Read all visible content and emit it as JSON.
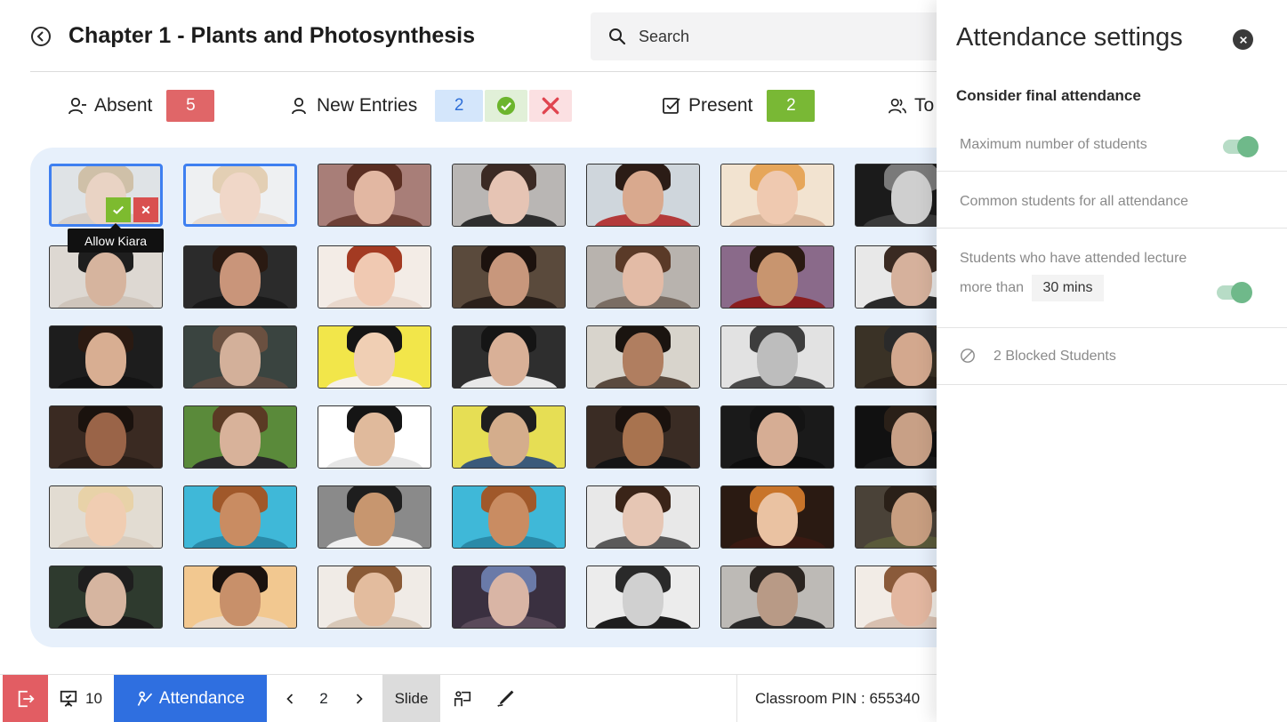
{
  "header": {
    "title": "Chapter 1 - Plants and Photosynthesis",
    "search_placeholder": "Search"
  },
  "stats": {
    "absent_label": "Absent",
    "absent_count": "5",
    "new_entries_label": "New Entries",
    "new_entries_count": "2",
    "present_label": "Present",
    "present_count": "2",
    "total_label": "To"
  },
  "tooltip": "Allow Kiara",
  "colors": {
    "primary": "#2f6fe0",
    "absent": "#e06668",
    "present": "#79b835",
    "panel_toggle": "#6fb98a"
  },
  "students": [
    {
      "name": "Kiara",
      "skin": "#e9d3c4",
      "hair": "#cfc0a8",
      "bg": "#dfe3e6",
      "body": "#d7cfc8"
    },
    {
      "name": "",
      "skin": "#f0d7c8",
      "hair": "#e3cfb4",
      "bg": "#eef0f2",
      "body": "#e8dcd2"
    },
    {
      "name": "",
      "skin": "#e2b7a2",
      "hair": "#5a2e22",
      "bg": "#a87e78",
      "body": "#6d4036"
    },
    {
      "name": "",
      "skin": "#e6c4b4",
      "hair": "#3b2a24",
      "bg": "#b9b6b4",
      "body": "#2e2e2e"
    },
    {
      "name": "",
      "skin": "#d9a98e",
      "hair": "#2b1c16",
      "bg": "#cfd6dc",
      "body": "#b33a3a"
    },
    {
      "name": "",
      "skin": "#efc9b0",
      "hair": "#e6a65a",
      "bg": "#f2e3d0",
      "body": "#d8b59a"
    },
    {
      "name": "",
      "skin": "#cfcfcf",
      "hair": "#7a7a7a",
      "bg": "#1b1b1b",
      "body": "#3a3a3a"
    },
    {
      "name": "",
      "skin": "#d6b49e",
      "hair": "#1e1e1e",
      "bg": "#ddd8d2",
      "body": "#cfc5bb"
    },
    {
      "name": "",
      "skin": "#c9957a",
      "hair": "#2a1a12",
      "bg": "#2b2b2b",
      "body": "#1a1a1a"
    },
    {
      "name": "",
      "skin": "#f0c9b2",
      "hair": "#a33a22",
      "bg": "#f3ece6",
      "body": "#e9d8cc"
    },
    {
      "name": "",
      "skin": "#c8977c",
      "hair": "#1c120e",
      "bg": "#5a4a3c",
      "body": "#2a201a"
    },
    {
      "name": "",
      "skin": "#e3bba6",
      "hair": "#5a3a28",
      "bg": "#b8b3ae",
      "body": "#7a6d63"
    },
    {
      "name": "",
      "skin": "#c8956f",
      "hair": "#2a1a12",
      "bg": "#8a6a8a",
      "body": "#8a1e1e"
    },
    {
      "name": "",
      "skin": "#d6b19c",
      "hair": "#3a2a22",
      "bg": "#e8e8e8",
      "body": "#2a2a2a"
    },
    {
      "name": "",
      "skin": "#d8ae92",
      "hair": "#2a1a12",
      "bg": "#1d1d1d",
      "body": "#141414"
    },
    {
      "name": "",
      "skin": "#d3b09a",
      "hair": "#6a5040",
      "bg": "#3a4440",
      "body": "#5a4a40"
    },
    {
      "name": "",
      "skin": "#f0cfb4",
      "hair": "#151515",
      "bg": "#f2e64a",
      "body": "#f5f0ea"
    },
    {
      "name": "",
      "skin": "#d9b097",
      "hair": "#151515",
      "bg": "#2e2e2e",
      "body": "#e8e8e8"
    },
    {
      "name": "",
      "skin": "#b07e60",
      "hair": "#1a1410",
      "bg": "#d8d4cc",
      "body": "#5a4a3e"
    },
    {
      "name": "",
      "skin": "#bdbdbd",
      "hair": "#3d3d3d",
      "bg": "#e2e2e2",
      "body": "#4a4a4a"
    },
    {
      "name": "",
      "skin": "#d3a88e",
      "hair": "#2a2a2a",
      "bg": "#3a3226",
      "body": "#2a221a"
    },
    {
      "name": "",
      "skin": "#9a6448",
      "hair": "#1a120e",
      "bg": "#3a2a22",
      "body": "#2a1e18"
    },
    {
      "name": "",
      "skin": "#d8b29a",
      "hair": "#5a3a24",
      "bg": "#5a8a3a",
      "body": "#2a2a2a"
    },
    {
      "name": "",
      "skin": "#e0ba9c",
      "hair": "#151515",
      "bg": "#ffffff",
      "body": "#e6e6e6"
    },
    {
      "name": "",
      "skin": "#d4ad8c",
      "hair": "#1e1e1e",
      "bg": "#e6de54",
      "body": "#3a5a7a"
    },
    {
      "name": "",
      "skin": "#a8734f",
      "hair": "#1a120e",
      "bg": "#3a2c24",
      "body": "#151515"
    },
    {
      "name": "",
      "skin": "#d6ad94",
      "hair": "#141414",
      "bg": "#1a1a1a",
      "body": "#0e0e0e"
    },
    {
      "name": "",
      "skin": "#c8a086",
      "hair": "#2a2018",
      "bg": "#111111",
      "body": "#1a1a1a"
    },
    {
      "name": "",
      "skin": "#f0cdb2",
      "hair": "#e8d2a8",
      "bg": "#e2dcd2",
      "body": "#d8ccbe"
    },
    {
      "name": "",
      "skin": "#c98c62",
      "hair": "#a0582a",
      "bg": "#3fb8d8",
      "body": "#2a8aa8"
    },
    {
      "name": "",
      "skin": "#c7966f",
      "hair": "#1e1e1e",
      "bg": "#8a8a8a",
      "body": "#f0f0f0"
    },
    {
      "name": "",
      "skin": "#c98c62",
      "hair": "#a0582a",
      "bg": "#3fb8d8",
      "body": "#2a8aa8"
    },
    {
      "name": "",
      "skin": "#e6c6b4",
      "hair": "#3a2418",
      "bg": "#e8e8e8",
      "body": "#5a5a5a"
    },
    {
      "name": "",
      "skin": "#eac2a2",
      "hair": "#c8742a",
      "bg": "#2a1a12",
      "body": "#3a1a12"
    },
    {
      "name": "",
      "skin": "#c89e80",
      "hair": "#2a2018",
      "bg": "#4a4238",
      "body": "#5a5a3a"
    },
    {
      "name": "",
      "skin": "#d6b5a0",
      "hair": "#1e1e1e",
      "bg": "#2e3a2e",
      "body": "#1a1a1a"
    },
    {
      "name": "",
      "skin": "#c8906a",
      "hair": "#1a120e",
      "bg": "#f2c890",
      "body": "#e8d8c8"
    },
    {
      "name": "",
      "skin": "#e3bc9e",
      "hair": "#8a5a36",
      "bg": "#f0ebe6",
      "body": "#d8c8b8"
    },
    {
      "name": "",
      "skin": "#d9b5a5",
      "hair": "#6a7aa8",
      "bg": "#3a3040",
      "body": "#5a4a5a"
    },
    {
      "name": "",
      "skin": "#d0d0d0",
      "hair": "#2a2a2a",
      "bg": "#ececec",
      "body": "#1e1e1e"
    },
    {
      "name": "",
      "skin": "#b89a86",
      "hair": "#2a2420",
      "bg": "#bdbab6",
      "body": "#2a2a2a"
    },
    {
      "name": "",
      "skin": "#e3b7a0",
      "hair": "#8a5a3a",
      "bg": "#f2ece6",
      "body": "#d8c0b0"
    }
  ],
  "toolbar": {
    "slides_count": "10",
    "attendance_label": "Attendance",
    "page_number": "2",
    "slide_label": "Slide",
    "classroom_pin": "Classroom PIN : 655340"
  },
  "settings": {
    "title": "Attendance settings",
    "subtitle": "Consider final attendance",
    "max_students_label": "Maximum number of students",
    "max_students_on": true,
    "common_students_label": "Common students for all attendance",
    "attended_label_line1": "Students who have attended lecture",
    "attended_label_line2": "more than",
    "attended_mins": "30 mins",
    "attended_on": true,
    "blocked_label": "2 Blocked Students"
  }
}
